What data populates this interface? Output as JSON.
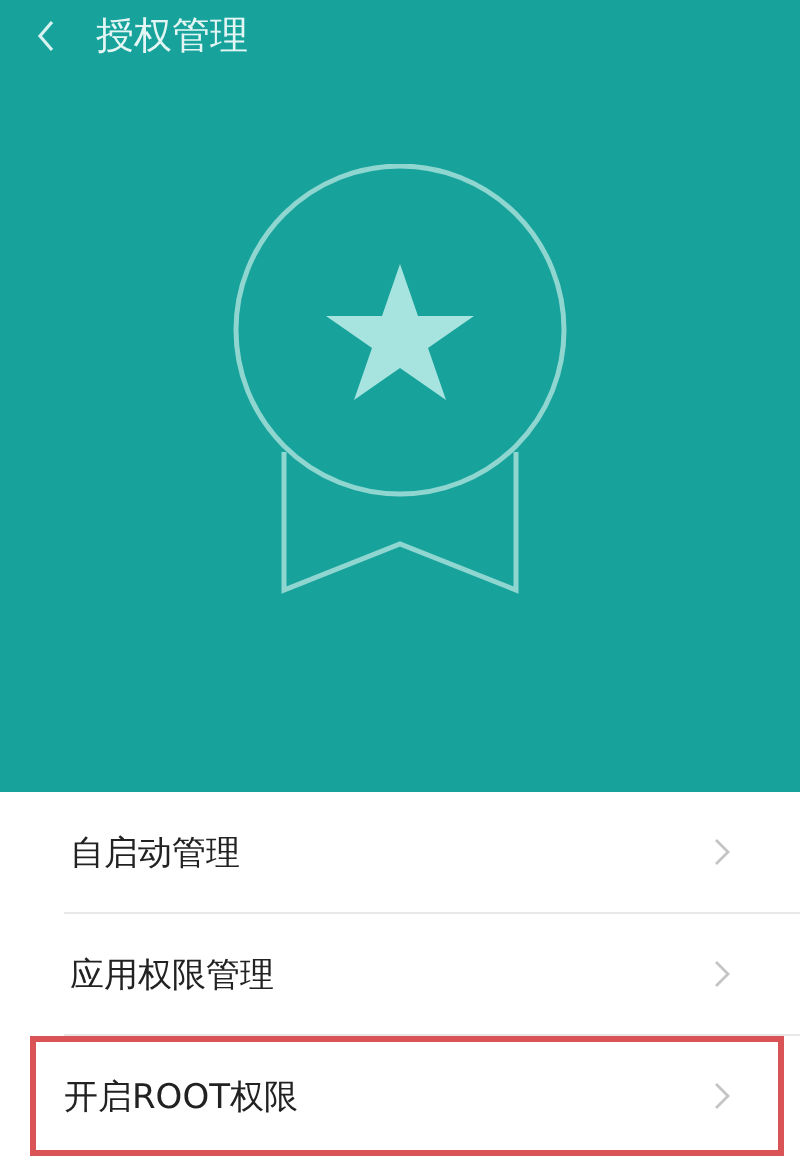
{
  "header": {
    "title": "授权管理"
  },
  "menu": [
    {
      "label": "自启动管理",
      "highlighted": false
    },
    {
      "label": "应用权限管理",
      "highlighted": false
    },
    {
      "label": "开启ROOT权限",
      "highlighted": true
    }
  ]
}
